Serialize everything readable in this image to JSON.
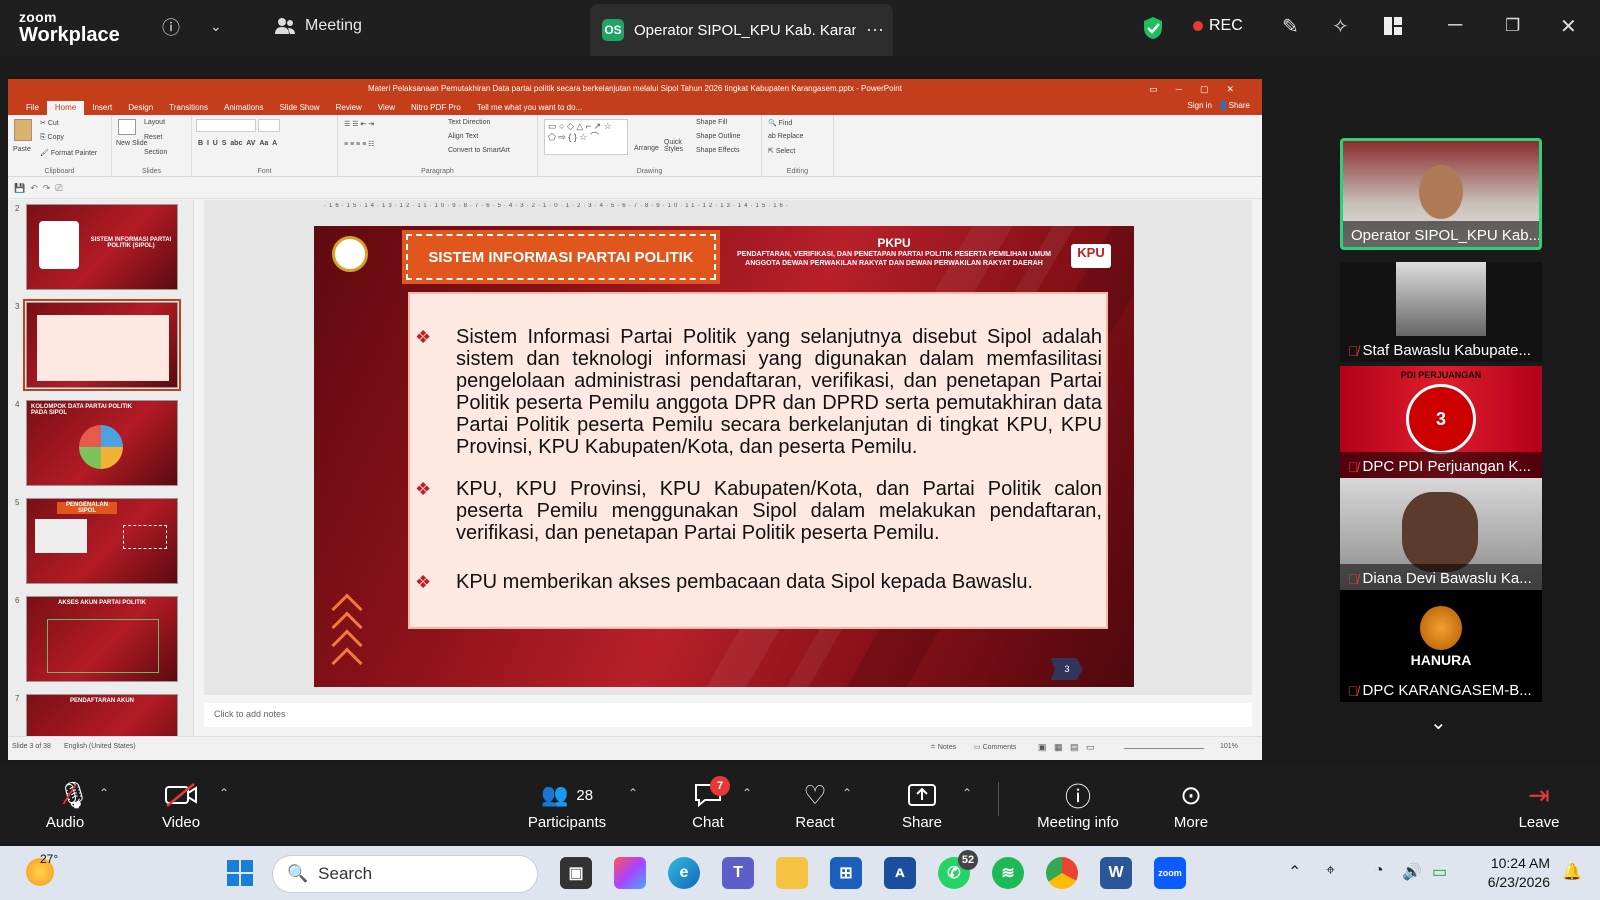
{
  "zoom": {
    "logo_line1": "zoom",
    "logo_line2": "Workplace",
    "meeting_label": "Meeting",
    "active_tab_badge": "OS",
    "active_tab_title": "Operator SIPOL_KPU Kab. Karang",
    "rec_label": "REC"
  },
  "ppt": {
    "window_title": "Materi Pelaksanaan Pemutakhiran Data partai politik secara berkelanjutan melalui Sipol Tahun 2026 tingkat Kabupaten Karangasem.pptx - PowerPoint",
    "tabs": [
      "File",
      "Home",
      "Insert",
      "Design",
      "Transitions",
      "Animations",
      "Slide Show",
      "Review",
      "View",
      "Nitro PDF Pro",
      "Tell me what you want to do..."
    ],
    "sign_in": "Sign in",
    "share": "Share",
    "ribbon": {
      "clipboard": {
        "paste": "Paste",
        "cut": "Cut",
        "copy": "Copy",
        "format_painter": "Format Painter",
        "label": "Clipboard"
      },
      "slides": {
        "new_slide": "New Slide",
        "layout": "Layout",
        "reset": "Reset",
        "section": "Section",
        "label": "Slides"
      },
      "font_label": "Font",
      "paragraph": {
        "text_direction": "Text Direction",
        "align_text": "Align Text",
        "convert": "Convert to SmartArt",
        "label": "Paragraph"
      },
      "drawing": {
        "arrange": "Arrange",
        "quick_styles": "Quick Styles",
        "shape_fill": "Shape Fill",
        "shape_outline": "Shape Outline",
        "shape_effects": "Shape Effects",
        "label": "Drawing"
      },
      "editing": {
        "find": "Find",
        "replace": "Replace",
        "select": "Select",
        "label": "Editing"
      }
    },
    "thumbnails": [
      {
        "num": "2",
        "title": "SISTEM INFORMASI PARTAI POLITIK (SIPOL)"
      },
      {
        "num": "3",
        "title": ""
      },
      {
        "num": "4",
        "title": "KOLOMPOK DATA PARTAI POLITIK PADA SIPOL"
      },
      {
        "num": "5",
        "title": "PENGENALAN SIPOL"
      },
      {
        "num": "6",
        "title": "AKSES AKUN PARTAI POLITIK"
      },
      {
        "num": "7",
        "title": "PENDAFTARAN AKUN"
      }
    ],
    "slide": {
      "banner": "SISTEM INFORMASI PARTAI POLITIK",
      "pkpu_title": "PKPU",
      "pkpu_sub1": "PENDAFTARAN, VERIFIKASI, DAN PENETAPAN PARTAI POLITIK PESERTA PEMILIHAN UMUM",
      "pkpu_sub2": "ANGGOTA DEWAN PERWAKILAN RAKYAT DAN DEWAN PERWAKILAN RAKYAT DAERAH",
      "kpu_badge": "KPU",
      "bullets": [
        "Sistem Informasi Partai Politik yang selanjutnya disebut Sipol adalah sistem dan teknologi informasi yang digunakan dalam memfasilitasi pengelolaan administrasi pendaftaran, verifikasi, dan penetapan Partai Politik peserta Pemilu anggota DPR dan DPRD serta pemutakhiran data Partai Politik peserta Pemilu secara berkelanjutan di tingkat KPU, KPU Provinsi, KPU Kabupaten/Kota, dan peserta Pemilu.",
        "KPU, KPU Provinsi, KPU Kabupaten/Kota, dan Partai Politik calon peserta Pemilu menggunakan Sipol dalam melakukan pendaftaran, verifikasi, dan penetapan Partai Politik peserta Pemilu.",
        "KPU memberikan akses pembacaan data Sipol kepada Bawaslu."
      ],
      "page_number": "3"
    },
    "notes_placeholder": "Click to add notes",
    "status": {
      "slide_of": "Slide 3 of 38",
      "language": "English (United States)",
      "notes": "Notes",
      "comments": "Comments",
      "zoom": "101%"
    }
  },
  "participants": [
    {
      "name": "Operator SIPOL_KPU Kab...",
      "muted": false
    },
    {
      "name": "Staf Bawaslu Kabupate...",
      "muted": true
    },
    {
      "name": "DPC PDI Perjuangan K...",
      "muted": true
    },
    {
      "name": "Diana Devi Bawaslu Ka...",
      "muted": true
    },
    {
      "name": "DPC KARANGASEM-B...",
      "muted": true
    }
  ],
  "pdi_logo_text": "PDI PERJUANGAN",
  "pdi_number": "3",
  "hanura_text": "HANURA",
  "controls": {
    "audio": "Audio",
    "video": "Video",
    "participants": "Participants",
    "participants_count": "28",
    "chat": "Chat",
    "chat_badge": "7",
    "react": "React",
    "share": "Share",
    "meeting_info": "Meeting info",
    "more": "More",
    "leave": "Leave"
  },
  "taskbar": {
    "weather": "27°",
    "search_placeholder": "Search",
    "whatsapp_badge": "52",
    "time": "10:24 AM",
    "date": "6/23/2026"
  },
  "colors": {
    "ppt_accent": "#c43e1c",
    "slide_red": "#b8202a",
    "slide_banner": "#e0561d",
    "active_speaker": "#2fd07a"
  }
}
